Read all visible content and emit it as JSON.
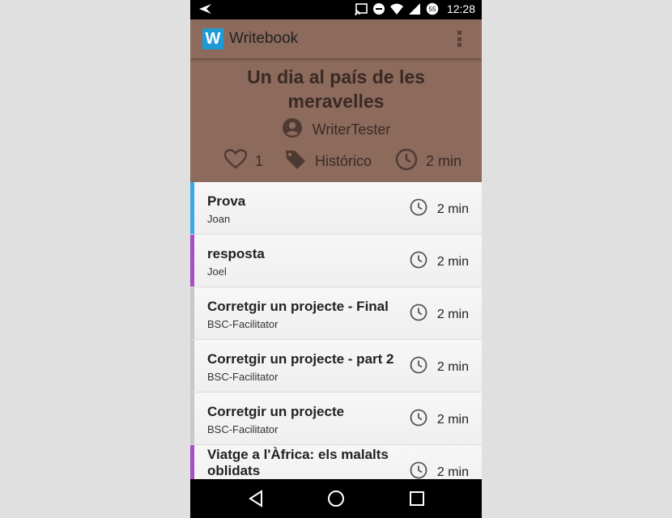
{
  "status_bar": {
    "time": "12:28",
    "battery_level": "55",
    "icons": [
      "back-arrow-icon",
      "cast-icon",
      "do-not-disturb-icon",
      "wifi-icon",
      "signal-icon",
      "battery-icon"
    ]
  },
  "app_bar": {
    "logo_letter": "W",
    "title": "Writebook",
    "menu_icon": "overflow-menu-icon"
  },
  "story": {
    "title": "Un dia al país de les meravelles",
    "author": "WriterTester",
    "likes": "1",
    "category": "Histórico",
    "reading_time": "2 min"
  },
  "chapters": [
    {
      "title": "Prova",
      "author": "Joan",
      "duration": "2 min",
      "color": "#3aa7e8"
    },
    {
      "title": "resposta",
      "author": "Joel",
      "duration": "2 min",
      "color": "#a64fc2"
    },
    {
      "title": "Corretgir un projecte - Final",
      "author": "BSC-Facilitator",
      "duration": "2 min",
      "color": "#c8c8c8"
    },
    {
      "title": "Corretgir un projecte - part 2",
      "author": "BSC-Facilitator",
      "duration": "2 min",
      "color": "#c8c8c8"
    },
    {
      "title": "Corretgir un projecte",
      "author": "BSC-Facilitator",
      "duration": "2 min",
      "color": "#c8c8c8"
    },
    {
      "title": "Viatge a l'Àfrica: els malalts oblidats",
      "author": "",
      "duration": "2 min",
      "color": "#a64fc2"
    }
  ],
  "nav_bar": {
    "buttons": [
      "back-nav-icon",
      "home-nav-icon",
      "recents-nav-icon"
    ]
  },
  "colors": {
    "header_bg": "#8c6a5c",
    "logo_bg": "#1e9bd7"
  }
}
